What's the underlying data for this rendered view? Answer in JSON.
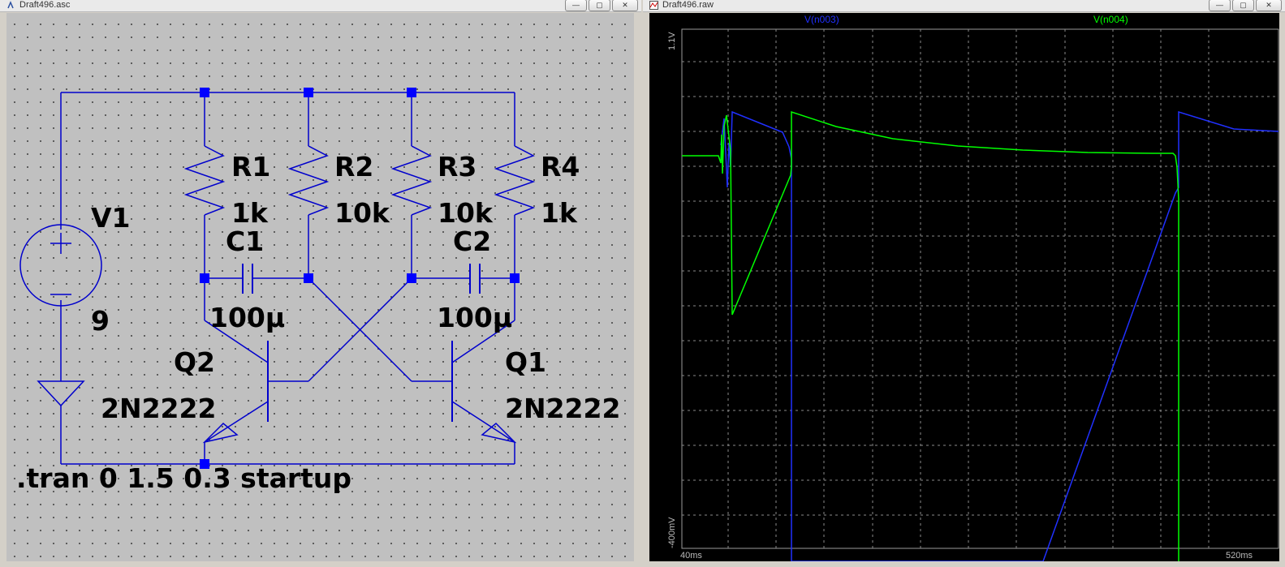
{
  "schematic_window": {
    "title": "Draft496.asc",
    "buttons": {
      "minimize": "—",
      "maximize": "▢",
      "close": "✕"
    }
  },
  "waveform_window": {
    "title": "Draft496.raw",
    "buttons": {
      "minimize": "—",
      "maximize": "▢",
      "close": "✕"
    }
  },
  "schematic": {
    "components": {
      "R1": {
        "name": "R1",
        "value": "1k"
      },
      "R2": {
        "name": "R2",
        "value": "10k"
      },
      "R3": {
        "name": "R3",
        "value": "10k"
      },
      "R4": {
        "name": "R4",
        "value": "1k"
      },
      "C1": {
        "name": "C1",
        "value": "100µ"
      },
      "C2": {
        "name": "C2",
        "value": "100µ"
      },
      "V1": {
        "name": "V1",
        "value": "9"
      },
      "Q1": {
        "name": "Q1",
        "value": "2N2222"
      },
      "Q2": {
        "name": "Q2",
        "value": "2N2222"
      }
    },
    "directive": ".tran 0 1.5 0.3 startup",
    "wire_color": "#0000cc",
    "junction_color": "#0000ff"
  },
  "waveform": {
    "traces": [
      {
        "label": "V(n003)",
        "color": "#2030ff"
      },
      {
        "label": "V(n004)",
        "color": "#00ff00"
      }
    ],
    "y_axis": {
      "top": "1.1V",
      "bottom": "-400mV"
    },
    "x_axis": {
      "left": "40ms",
      "right": "520ms"
    },
    "grid": true
  }
}
